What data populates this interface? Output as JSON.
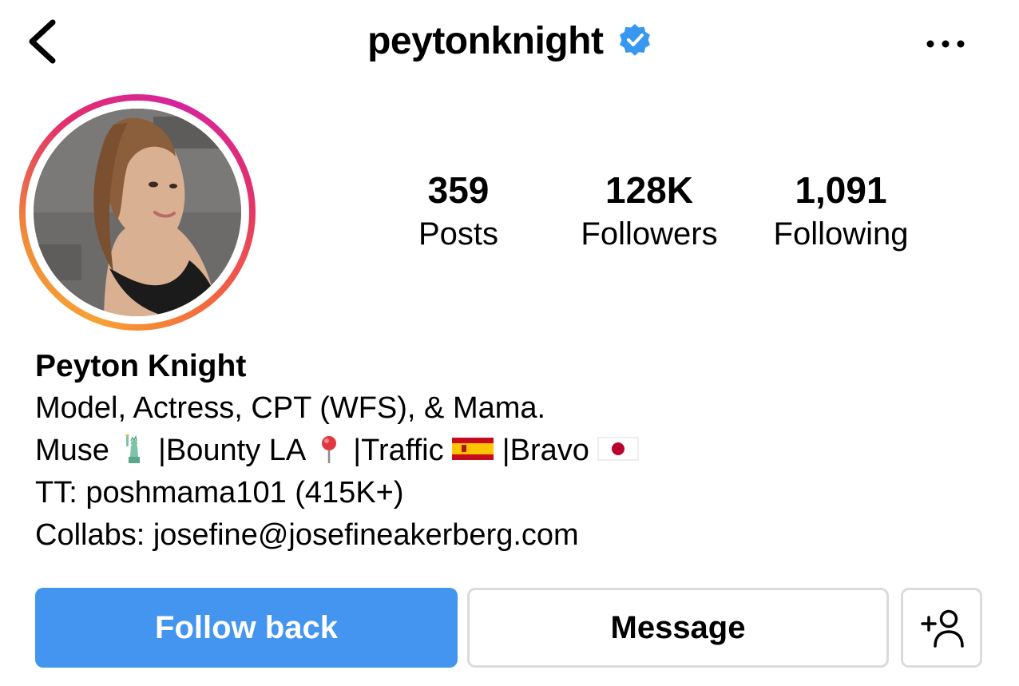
{
  "header": {
    "username": "peytonknight",
    "verified_icon": "verified-badge-icon",
    "back_icon": "chevron-left-icon",
    "more_icon": "more-horizontal-icon"
  },
  "stats": [
    {
      "value": "359",
      "label": "Posts"
    },
    {
      "value": "128K",
      "label": "Followers"
    },
    {
      "value": "1,091",
      "label": "Following"
    }
  ],
  "bio": {
    "name": "Peyton Knight",
    "line1": "Model, Actress, CPT (WFS), & Mama.",
    "line2": {
      "part1": "Muse",
      "part2": "|Bounty LA",
      "part3": "|Traffic",
      "part4": "|Bravo"
    },
    "line3": "TT: poshmama101 (415K+)",
    "line4": "Collabs: josefine@josefineakerberg.com"
  },
  "actions": {
    "follow_label": "Follow back",
    "message_label": "Message",
    "add_user_icon": "add-user-icon"
  },
  "colors": {
    "verified_blue": "#3897f0",
    "follow_button": "#4395f0",
    "border": "#dbdbdb",
    "ring_orange": "#f7a234",
    "ring_pink": "#e1306c"
  }
}
